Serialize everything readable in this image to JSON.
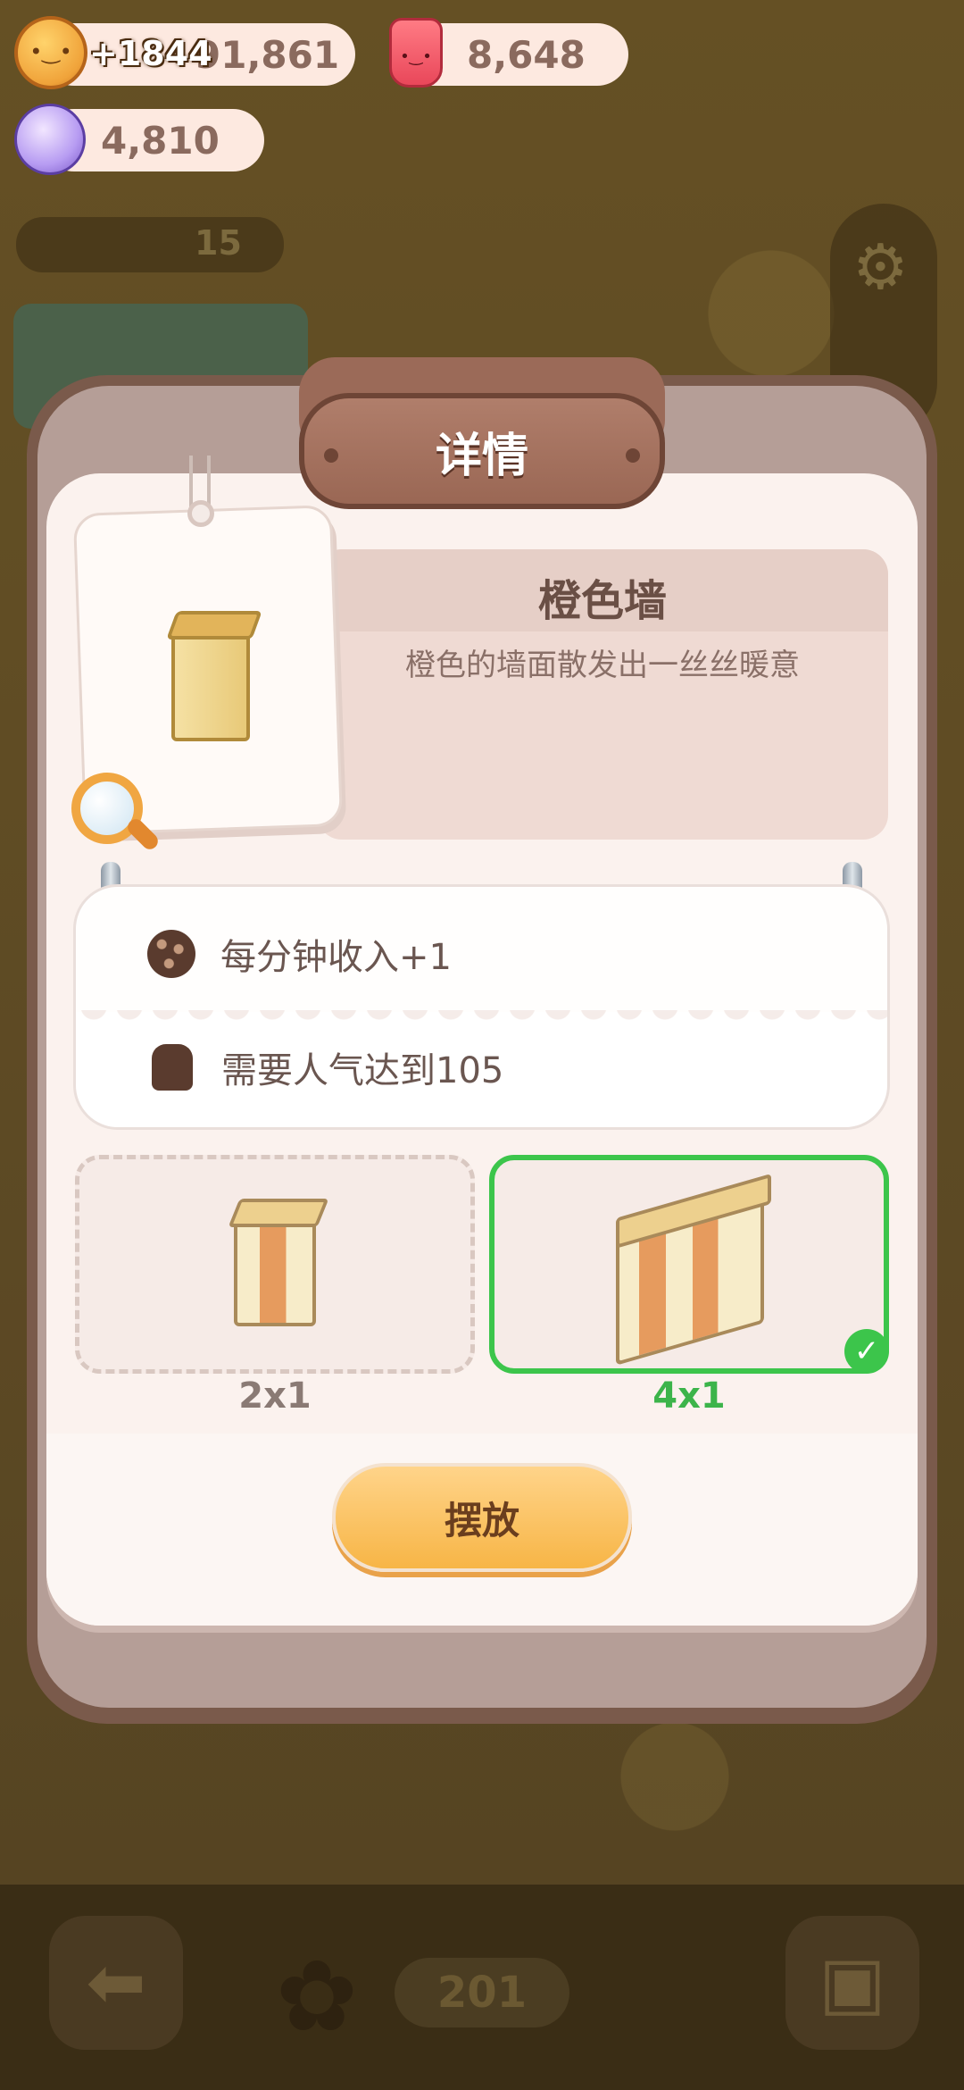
{
  "currency": {
    "coins": "91,861",
    "coin_gain": "+1844",
    "gems": "8,648",
    "candy": "4,810"
  },
  "background": {
    "popularity": "15",
    "bottom_count": "201"
  },
  "modal": {
    "title": "详情",
    "item_name": "橙色墙",
    "item_desc": "橙色的墙面散发出一丝丝暖意",
    "stats": {
      "income": "每分钟收入+1",
      "requirement": "需要人气达到105"
    },
    "sizes": [
      {
        "label": "2x1",
        "selected": false
      },
      {
        "label": "4x1",
        "selected": true
      }
    ],
    "place_button": "摆放"
  },
  "colors": {
    "accent_green": "#3cc54b",
    "button_orange": "#f7b546",
    "modal_brown": "#7a5a4b"
  },
  "icons": {
    "coin": "cookie-coin-icon",
    "gem": "jelly-cup-icon",
    "candy": "candy-icon",
    "magnifier": "magnifier-icon",
    "income": "cookie-icon",
    "requirement": "pudding-icon",
    "check": "check-icon"
  }
}
